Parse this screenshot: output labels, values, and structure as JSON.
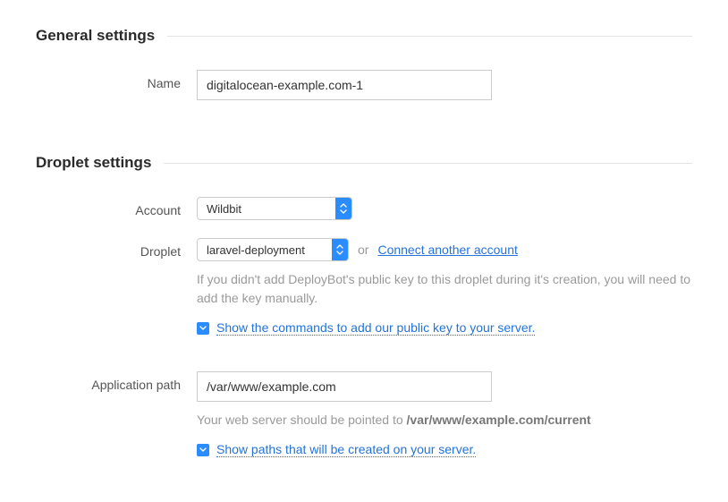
{
  "general": {
    "heading": "General settings",
    "name_label": "Name",
    "name_value": "digitalocean-example.com-1"
  },
  "droplet": {
    "heading": "Droplet settings",
    "account_label": "Account",
    "account_value": "Wildbit",
    "droplet_label": "Droplet",
    "droplet_value": "laravel-deployment",
    "or_text": "or",
    "connect_link": "Connect another account",
    "droplet_helper": "If you didn't add DeployBot's public key to this droplet during it's creation, you will need to add the key manually.",
    "show_commands_link": "Show the commands to add our public key to your server",
    "app_path_label": "Application path",
    "app_path_value": "/var/www/example.com",
    "app_path_helper_prefix": "Your web server should be pointed to ",
    "app_path_helper_bold": "/var/www/example.com/current",
    "show_paths_link": "Show paths that will be created on your server"
  }
}
